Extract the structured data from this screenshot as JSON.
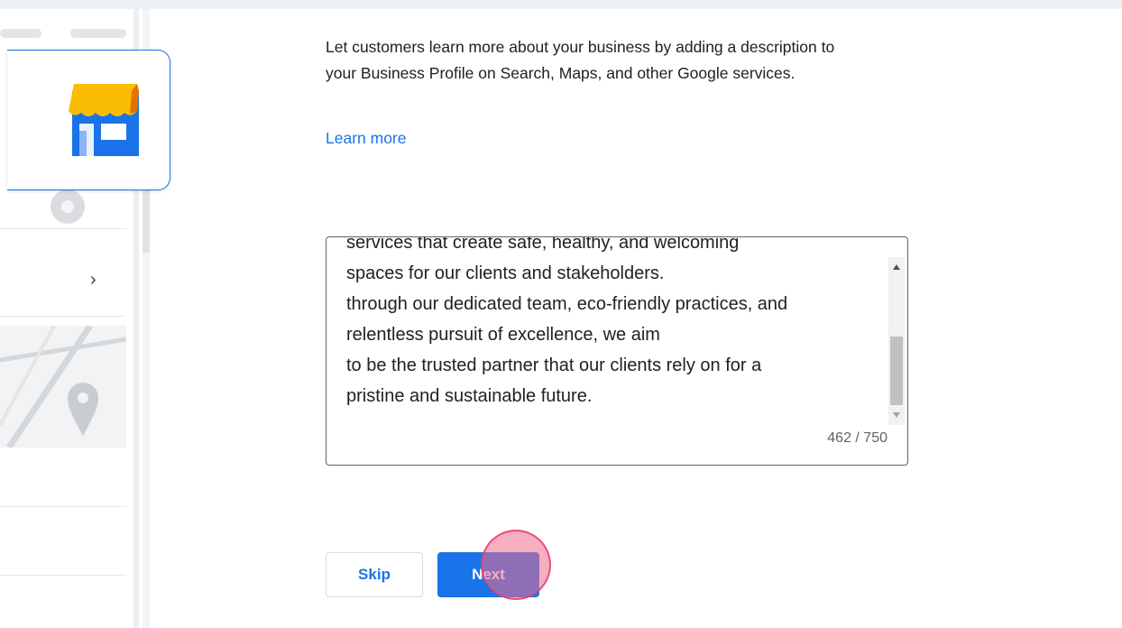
{
  "description": "Let customers learn more about your business by adding a description to your Business Profile on Search, Maps, and other Google services.",
  "learn_more": "Learn more",
  "textarea": {
    "visible_lines": [
      "services that create safe, healthy, and welcoming",
      "spaces for our clients and stakeholders.",
      "through our dedicated team, eco-friendly practices, and",
      "relentless pursuit of excellence, we aim",
      "to be the trusted partner that our clients rely on for a",
      "pristine and sustainable future."
    ],
    "char_count": "462 / 750"
  },
  "buttons": {
    "skip": "Skip",
    "next": "Next"
  },
  "colors": {
    "primary": "#1a73e8",
    "text": "#202124",
    "muted": "#5f6368",
    "store_awning": "#fbbc04",
    "click_indicator": "#ee6c8e"
  },
  "icons": {
    "store": "storefront-icon",
    "chevron": "chevron-right-icon",
    "globe": "globe-icon",
    "map_pin": "map-pin-icon"
  },
  "left_panel": {
    "chevron_glyph": "›"
  }
}
